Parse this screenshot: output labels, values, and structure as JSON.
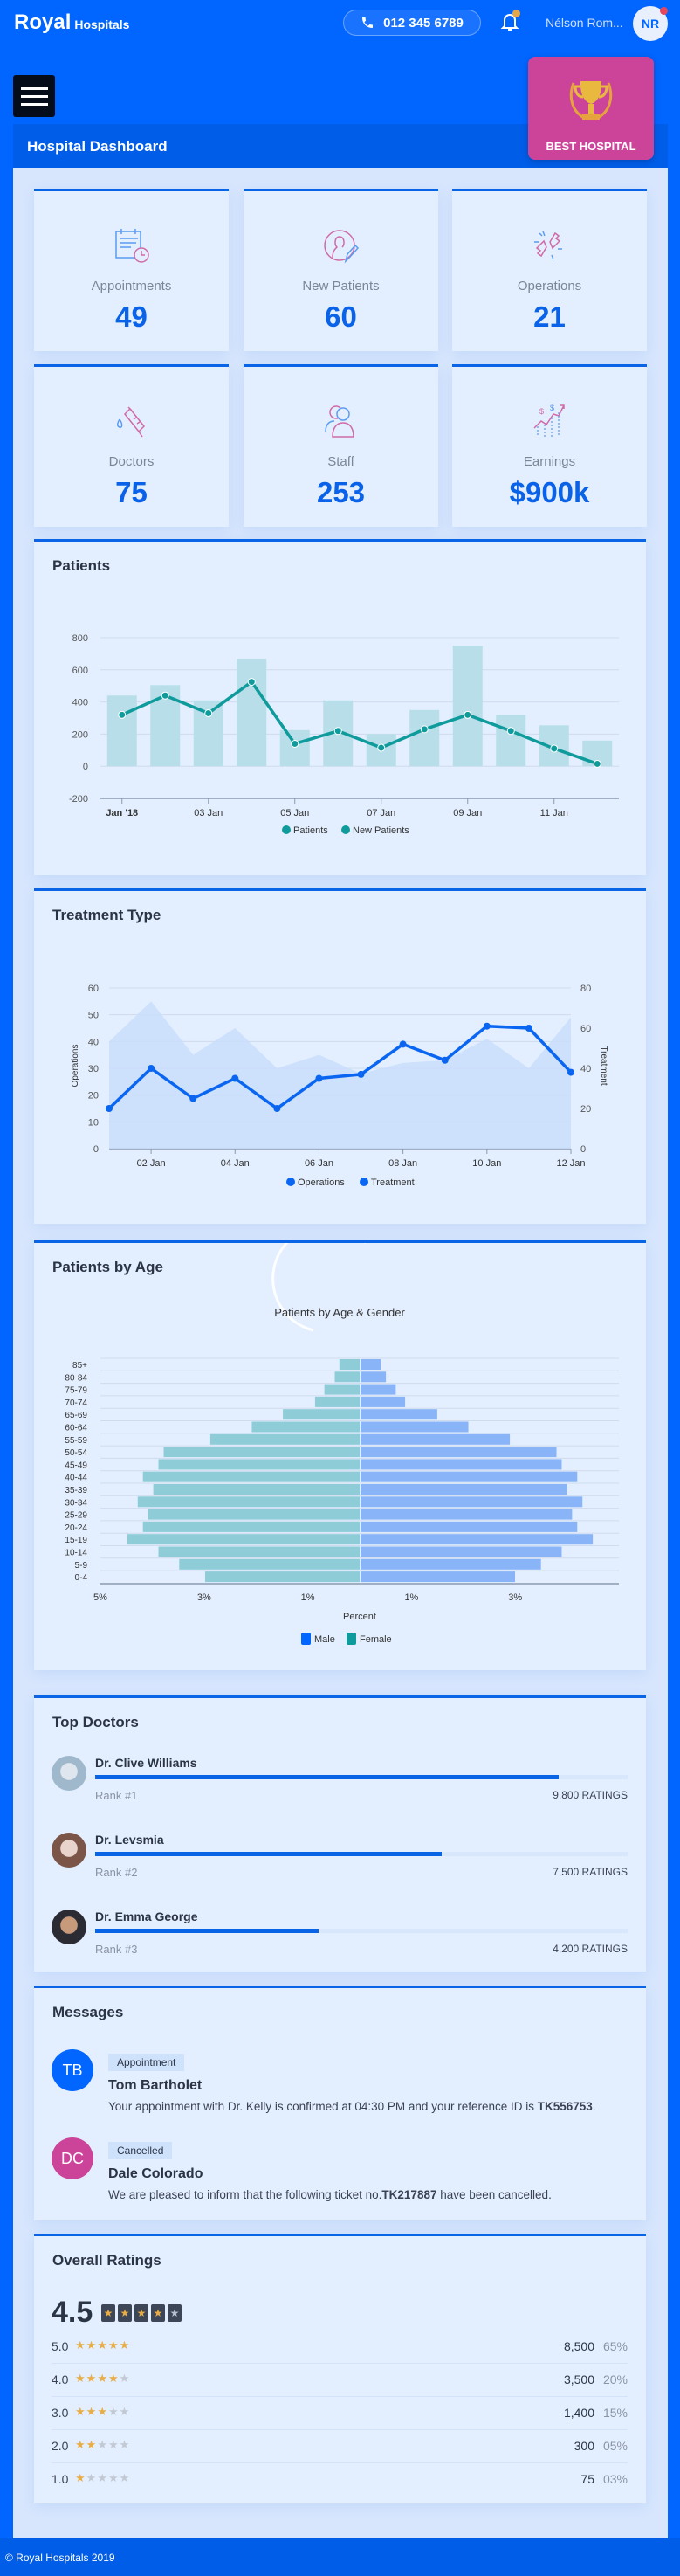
{
  "header": {
    "brand": "Royal",
    "brand_sub": "Hospitals",
    "phone": "012 345 6789",
    "user_name": "Nélson Rom...",
    "user_initials": "NR",
    "icons": [
      "phone-icon",
      "bell-icon"
    ]
  },
  "page": {
    "menu_icon": "hamburger-icon",
    "title": "Hospital Dashboard",
    "badge": "BEST HOSPITAL",
    "badge_icon": "trophy-icon"
  },
  "colors": {
    "primary": "#0066ff",
    "badge": "#cc4499",
    "teal": "#0f9b9b",
    "star": "#e8ad45"
  },
  "stats": [
    {
      "label": "Appointments",
      "value": "49",
      "icon": "calendar-clock-icon"
    },
    {
      "label": "New Patients",
      "value": "60",
      "icon": "patient-edit-icon"
    },
    {
      "label": "Operations",
      "value": "21",
      "icon": "bone-icon"
    },
    {
      "label": "Doctors",
      "value": "75",
      "icon": "syringe-icon"
    },
    {
      "label": "Staff",
      "value": "253",
      "icon": "users-icon"
    },
    {
      "label": "Earnings",
      "value": "$900k",
      "icon": "earnings-chart-icon"
    }
  ],
  "patients_card": {
    "title": "Patients"
  },
  "treatment_card": {
    "title": "Treatment Type"
  },
  "age_card": {
    "title": "Patients by Age"
  },
  "chart_data": [
    {
      "type": "bar",
      "x": [
        "Jan '18",
        "02 Jan",
        "03 Jan",
        "04 Jan",
        "05 Jan",
        "06 Jan",
        "07 Jan",
        "08 Jan",
        "09 Jan",
        "10 Jan",
        "11 Jan",
        "12 Jan"
      ],
      "x_tick_labels": [
        "Jan '18",
        "03 Jan",
        "05 Jan",
        "07 Jan",
        "09 Jan",
        "11 Jan"
      ],
      "ylim": [
        -200,
        800
      ],
      "yticks": [
        800,
        600,
        400,
        200,
        0,
        -200
      ],
      "grid": true,
      "legend": "bottom",
      "series": [
        {
          "name": "Patients",
          "type": "bar",
          "color": "#b8dfe9",
          "values": [
            440,
            505,
            410,
            670,
            225,
            410,
            200,
            350,
            750,
            320,
            255,
            160
          ]
        },
        {
          "name": "New Patients",
          "type": "line",
          "color": "#0f9b9b",
          "values": [
            320,
            440,
            330,
            525,
            140,
            220,
            115,
            230,
            320,
            220,
            110,
            15
          ]
        }
      ]
    },
    {
      "type": "area",
      "x": [
        "01 Jan",
        "02 Jan",
        "03 Jan",
        "04 Jan",
        "05 Jan",
        "06 Jan",
        "07 Jan",
        "08 Jan",
        "09 Jan",
        "10 Jan",
        "11 Jan",
        "12 Jan"
      ],
      "x_tick_labels": [
        "02 Jan",
        "04 Jan",
        "06 Jan",
        "08 Jan",
        "10 Jan",
        "12 Jan"
      ],
      "ylabel": "Operations",
      "ylim": [
        0,
        60
      ],
      "yticks": [
        60,
        50,
        40,
        30,
        20,
        10,
        0
      ],
      "y2label": "Treatment",
      "y2lim": [
        0,
        80
      ],
      "y2ticks": [
        80,
        60,
        40,
        20,
        0
      ],
      "grid": true,
      "legend": "bottom",
      "series": [
        {
          "name": "Operations",
          "type": "area",
          "axis": "left",
          "color": "#c9ddfb",
          "values": [
            40,
            55,
            35,
            45,
            30,
            35,
            28,
            32,
            33,
            41,
            30,
            49
          ]
        },
        {
          "name": "Treatment",
          "type": "line",
          "axis": "right",
          "color": "#0a66f0",
          "values": [
            20,
            40,
            25,
            35,
            20,
            35,
            37,
            52,
            44,
            61,
            60,
            38
          ]
        }
      ]
    },
    {
      "type": "bar",
      "orientation": "horizontal",
      "title": "Patients by Age & Gender",
      "xlabel": "Percent",
      "categories": [
        "85+",
        "80-84",
        "75-79",
        "70-74",
        "65-69",
        "60-64",
        "55-59",
        "50-54",
        "45-49",
        "40-44",
        "35-39",
        "30-34",
        "25-29",
        "20-24",
        "15-19",
        "10-14",
        "5-9",
        "0-4"
      ],
      "x_tick_labels": [
        "5%",
        "3%",
        "1%",
        "1%",
        "3%"
      ],
      "xlim": [
        -5,
        5
      ],
      "legend": "bottom",
      "series": [
        {
          "name": "Male",
          "color": "#0066ff",
          "bar_color": "#8ab4f8",
          "side": "right",
          "values": [
            0.39,
            0.49,
            0.68,
            0.86,
            1.48,
            2.08,
            2.88,
            3.78,
            3.88,
            4.18,
            3.98,
            4.28,
            4.08,
            4.18,
            4.48,
            3.88,
            3.48,
            2.98
          ]
        },
        {
          "name": "Female",
          "color": "#0f9b9b",
          "bar_color": "#8ecdd8",
          "side": "left",
          "values": [
            0.39,
            0.48,
            0.68,
            0.86,
            1.48,
            2.08,
            2.88,
            3.78,
            3.88,
            4.18,
            3.98,
            4.28,
            4.08,
            4.18,
            4.48,
            3.88,
            3.48,
            2.98
          ]
        }
      ]
    }
  ],
  "top_doctors": {
    "title": "Top Doctors",
    "items": [
      {
        "name": "Dr. Clive Williams",
        "rank": "Rank #1",
        "ratings": "9,800 RATINGS",
        "progress": 0.87
      },
      {
        "name": "Dr. Levsmia",
        "rank": "Rank #2",
        "ratings": "7,500 RATINGS",
        "progress": 0.65
      },
      {
        "name": "Dr. Emma George",
        "rank": "Rank #3",
        "ratings": "4,200 RATINGS",
        "progress": 0.42
      }
    ]
  },
  "messages": {
    "title": "Messages",
    "items": [
      {
        "initials": "TB",
        "color": "#0066ff",
        "tag": "Appointment",
        "name": "Tom Bartholet",
        "text": "Your appointment with Dr. Kelly is confirmed at 04:30 PM and your reference ID is ",
        "ref": "TK556753",
        "tail": "."
      },
      {
        "initials": "DC",
        "color": "#cc4499",
        "tag": "Cancelled",
        "name": "Dale Colorado",
        "text": "We are pleased to inform that the following ticket no.",
        "ref": "TK217887",
        "tail": " have been cancelled."
      }
    ]
  },
  "ratings": {
    "title": "Overall Ratings",
    "overall": "4.5",
    "overall_stars": 4.5,
    "rows": [
      {
        "score": "5.0",
        "stars": 5,
        "count": "8,500",
        "percent": "65%"
      },
      {
        "score": "4.0",
        "stars": 4,
        "count": "3,500",
        "percent": "20%"
      },
      {
        "score": "3.0",
        "stars": 3,
        "count": "1,400",
        "percent": "15%"
      },
      {
        "score": "2.0",
        "stars": 2,
        "count": "300",
        "percent": "05%"
      },
      {
        "score": "1.0",
        "stars": 1,
        "count": "75",
        "percent": "03%"
      }
    ]
  },
  "footer": {
    "text": "© Royal Hospitals 2019"
  }
}
